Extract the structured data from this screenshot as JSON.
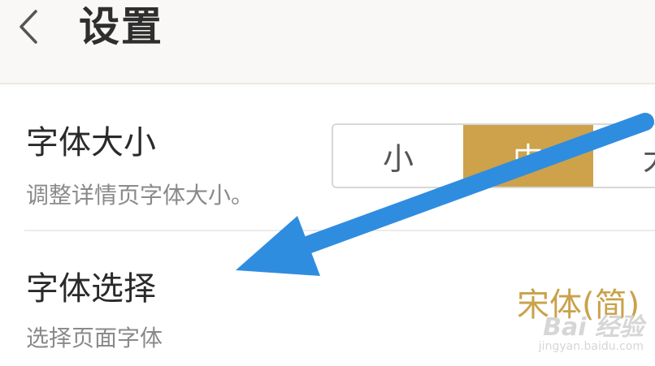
{
  "header": {
    "title": "设置",
    "back_icon": "chevron-left-icon"
  },
  "font_size_setting": {
    "title": "字体大小",
    "description": "调整详情页字体大小。",
    "options": [
      "小",
      "中",
      "大"
    ],
    "selected": "中"
  },
  "font_family_setting": {
    "title": "字体选择",
    "description": "选择页面字体",
    "value": "宋体(简)"
  },
  "watermark": {
    "logo": "Bai 经验",
    "url": "jingyan.baidu.com"
  },
  "colors": {
    "accent": "#cda24b",
    "arrow": "#2f8de0",
    "header_bg": "#faf8f6"
  }
}
